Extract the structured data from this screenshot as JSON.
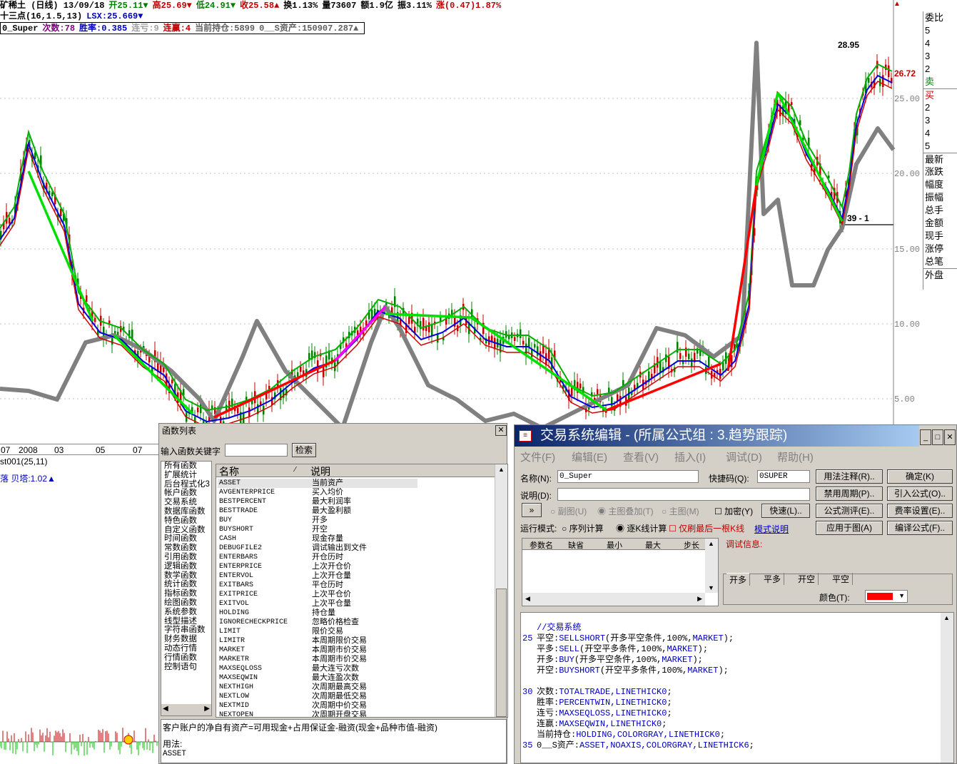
{
  "header": {
    "row1": [
      {
        "t": "矿稀土 (日线) 13/09/18",
        "c": "#000"
      },
      {
        "t": "开25.11▼",
        "c": "#008000"
      },
      {
        "t": "高25.69▼",
        "c": "#c00000"
      },
      {
        "t": "低24.91▼",
        "c": "#008000"
      },
      {
        "t": "收25.58▲",
        "c": "#c00000"
      },
      {
        "t": "换1.13%",
        "c": "#000"
      },
      {
        "t": "量73607",
        "c": "#000"
      },
      {
        "t": "额1.9亿",
        "c": "#000"
      },
      {
        "t": "振3.11%",
        "c": "#000"
      },
      {
        "t": "涨(0.47)1.87%",
        "c": "#c00000"
      }
    ],
    "row2": [
      {
        "t": "十三点(16,1.5,13)",
        "c": "#000"
      },
      {
        "t": "LSX:25.669▼",
        "c": "#0000c0"
      }
    ],
    "row3": [
      {
        "t": "0_Super",
        "c": "#000"
      },
      {
        "t": "次数:78",
        "c": "#800080"
      },
      {
        "t": "胜率:0.385",
        "c": "#0000c0"
      },
      {
        "t": "连亏:9",
        "c": "#a0a0a0"
      },
      {
        "t": "连赢:4",
        "c": "#c00000"
      },
      {
        "t": "当前持仓:5899",
        "c": "#606060"
      },
      {
        "t": "0__S资产:150907.287▲",
        "c": "#606060"
      }
    ]
  },
  "right_panel": [
    "委比",
    "5",
    "4",
    "3",
    "2",
    "卖",
    "买",
    "2",
    "3",
    "4",
    "5",
    "最新",
    "涨跌",
    "幅度",
    "振幅",
    "总手",
    "金额",
    "现手",
    "涨停",
    "总笔",
    "外盘"
  ],
  "price_ticks": [
    "25.00",
    "20.00",
    "15.00",
    "10.00",
    "5.00"
  ],
  "price_labels": {
    "high": "28.95",
    "last": "26.72",
    "cursor": "39 - 1"
  },
  "x_axis": [
    "07",
    "2008",
    "03",
    "05",
    "07"
  ],
  "sub_panel": {
    "title": "st001(25,11)",
    "indicator": "落 贝塔:1.02▲"
  },
  "func_list": {
    "title": "函数列表",
    "search_label": "输入函数关键字",
    "search_value": "",
    "search_button": "检索",
    "categories": [
      "所有函数",
      "扩展统计",
      "后台程式化3",
      "帐户函数",
      "交易系统",
      "数据库函数",
      "特色函数",
      "自定义函数",
      "时间函数",
      "常数函数",
      "引用函数",
      "逻辑函数",
      "数学函数",
      "统计函数",
      "指标函数",
      "绘图函数",
      "系统参数",
      "线型描述",
      "字符串函数",
      "财务数据",
      "动态行情",
      "行情函数",
      "控制语句"
    ],
    "col_name": "名称",
    "col_desc": "说明",
    "rows": [
      [
        "ASSET",
        "当前资产"
      ],
      [
        "AVGENTERPRICE",
        "买入均价"
      ],
      [
        "BESTPERCENT",
        "最大利润率"
      ],
      [
        "BESTTRADE",
        "最大盈利额"
      ],
      [
        "BUY",
        "开多"
      ],
      [
        "BUYSHORT",
        "开空"
      ],
      [
        "CASH",
        "现金存量"
      ],
      [
        "DEBUGFILE2",
        "调试输出到文件"
      ],
      [
        "ENTERBARS",
        "开仓历时"
      ],
      [
        "ENTERPRICE",
        "上次开仓价"
      ],
      [
        "ENTERVOL",
        "上次开仓量"
      ],
      [
        "EXITBARS",
        "平仓历时"
      ],
      [
        "EXITPRICE",
        "上次平仓价"
      ],
      [
        "EXITVOL",
        "上次平仓量"
      ],
      [
        "HOLDING",
        "持仓量"
      ],
      [
        "IGNORECHECKPRICE",
        "忽略价格检查"
      ],
      [
        "LIMIT",
        "限价交易"
      ],
      [
        "LIMITR",
        "本周期限价交易"
      ],
      [
        "MARKET",
        "本周期市价交易"
      ],
      [
        "MARKETR",
        "本周期市价交易"
      ],
      [
        "MAXSEQLOSS",
        "最大连亏次数"
      ],
      [
        "MAXSEQWIN",
        "最大连盈次数"
      ],
      [
        "NEXTHIGH",
        "次周期最高交易"
      ],
      [
        "NEXTLOW",
        "次周期最低交易"
      ],
      [
        "NEXTMID",
        "次周期中价交易"
      ],
      [
        "NEXTOPEN",
        "次周期开盘交易"
      ]
    ],
    "desc_text": "客户账户的净自有资产=可用现金+占用保证金-融资(现金+品种市值-融资)",
    "usage_label": "用法:",
    "usage_value": "ASSET"
  },
  "editor": {
    "title": "交易系统编辑 - (所属公式组 : 3.趋势跟踪)",
    "menu": [
      "文件(F)",
      "编辑(E)",
      "查看(V)",
      "插入(I)",
      "调试(D)",
      "帮助(H)"
    ],
    "name_label": "名称(N):",
    "name_value": "0_Super",
    "shortcut_label": "快捷码(Q):",
    "shortcut_value": "0SUPER",
    "desc_label": "说明(D):",
    "desc_value": "",
    "btn_usage": "用法注释(R)..",
    "btn_ok": "确定(K)",
    "btn_disable": "禁用周期(P)..",
    "btn_import": "引入公式(O)..",
    "btn_test": "公式测评(E)..",
    "btn_fee": "费率设置(E)..",
    "btn_apply": "应用于图(A)",
    "btn_compile": "编译公式(F)..",
    "btn_expand": "»",
    "opt_sub": "副图(U)",
    "opt_main_overlay": "主图叠加(T)",
    "opt_main": "主图(M)",
    "opt_encrypt": "加密(Y)",
    "btn_quick": "快速(L)..",
    "run_mode_label": "运行模式:",
    "run_seq": "序列计算",
    "run_bar": "逐K线计算",
    "only_last": "仅刷最后一根K线",
    "mode_link": "模式说明",
    "param_cols": [
      "参数名",
      "缺省",
      "最小",
      "最大",
      "步长"
    ],
    "debug_label": "调试信息:",
    "tabs": [
      "开多",
      "平多",
      "开空",
      "平空"
    ],
    "color_label": "颜色(T):",
    "color_value": "#ff0000",
    "code": [
      {
        "n": "",
        "t": [
          [
            "//交易系统",
            "#0000c0"
          ]
        ]
      },
      {
        "n": "25",
        "t": [
          [
            "平空:",
            "#000"
          ],
          [
            "SELLSHORT",
            "#0000c0"
          ],
          [
            "(开多平空条件,100%,",
            "#000"
          ],
          [
            "MARKET",
            "#0000c0"
          ],
          [
            ");",
            "#000"
          ]
        ]
      },
      {
        "n": "",
        "t": [
          [
            "平多:",
            "#000"
          ],
          [
            "SELL",
            "#0000c0"
          ],
          [
            "(开空平多条件,100%,",
            "#000"
          ],
          [
            "MARKET",
            "#0000c0"
          ],
          [
            ");",
            "#000"
          ]
        ]
      },
      {
        "n": "",
        "t": [
          [
            "开多:",
            "#000"
          ],
          [
            "BUY",
            "#0000c0"
          ],
          [
            "(开多平空条件,100%,",
            "#000"
          ],
          [
            "MARKET",
            "#0000c0"
          ],
          [
            ");",
            "#000"
          ]
        ]
      },
      {
        "n": "",
        "t": [
          [
            "开空:",
            "#000"
          ],
          [
            "BUYSHORT",
            "#0000c0"
          ],
          [
            "(开空平多条件,100%,",
            "#000"
          ],
          [
            "MARKET",
            "#0000c0"
          ],
          [
            ");",
            "#000"
          ]
        ]
      },
      {
        "n": "",
        "t": [
          [
            "",
            "#000"
          ]
        ]
      },
      {
        "n": "30",
        "t": [
          [
            "次数:",
            "#000"
          ],
          [
            "TOTALTRADE,LINETHICK0",
            "#0000c0"
          ],
          [
            ";",
            "#000"
          ]
        ]
      },
      {
        "n": "",
        "t": [
          [
            "胜率:",
            "#000"
          ],
          [
            "PERCENTWIN,LINETHICK0",
            "#0000c0"
          ],
          [
            ";",
            "#000"
          ]
        ]
      },
      {
        "n": "",
        "t": [
          [
            "连亏:",
            "#000"
          ],
          [
            "MAXSEQLOSS,LINETHICK0",
            "#0000c0"
          ],
          [
            ";",
            "#000"
          ]
        ]
      },
      {
        "n": "",
        "t": [
          [
            "连赢:",
            "#000"
          ],
          [
            "MAXSEQWIN,LINETHICK0",
            "#0000c0"
          ],
          [
            ";",
            "#000"
          ]
        ]
      },
      {
        "n": "",
        "t": [
          [
            "当前持仓:",
            "#000"
          ],
          [
            "HOLDING,COLORGRAY,LINETHICK0",
            "#0000c0"
          ],
          [
            ";",
            "#000"
          ]
        ]
      },
      {
        "n": "35",
        "t": [
          [
            "0__S资产:",
            "#000"
          ],
          [
            "ASSET,NOAXIS,COLORGRAY,LINETHICK6",
            "#0000c0"
          ],
          [
            ";",
            "#000"
          ]
        ]
      }
    ]
  }
}
